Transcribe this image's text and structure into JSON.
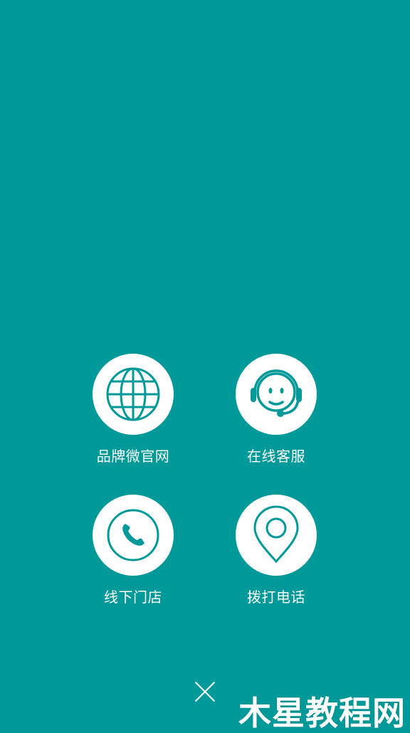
{
  "colors": {
    "background": "#009999",
    "icon_circle": "#ffffff",
    "icon_stroke": "#009999",
    "text": "#ffffff"
  },
  "menu": {
    "items": [
      {
        "label": "品牌微官网",
        "icon": "globe-icon"
      },
      {
        "label": "在线客服",
        "icon": "customer-service-headset-icon"
      },
      {
        "label": "线下门店",
        "icon": "phone-icon"
      },
      {
        "label": "拨打电话",
        "icon": "location-pin-icon"
      }
    ]
  },
  "close": {
    "icon": "close-icon"
  },
  "watermark": {
    "text": "木星教程网"
  }
}
